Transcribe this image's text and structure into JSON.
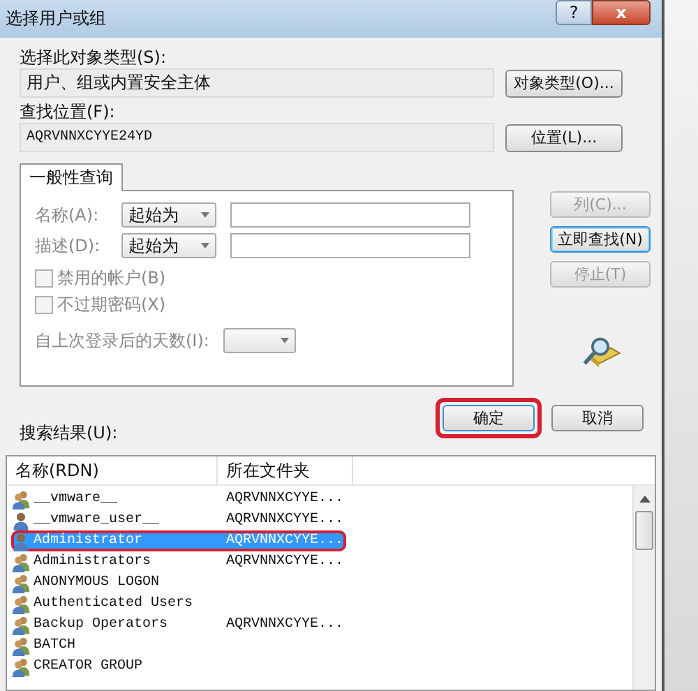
{
  "window": {
    "title": "选择用户或组",
    "help_button": "?",
    "close_button": "x"
  },
  "object_type": {
    "label": "选择此对象类型(S):",
    "value": "用户、组或内置安全主体",
    "button": "对象类型(O)..."
  },
  "location": {
    "label": "查找位置(F):",
    "value": "AQRVNNXCYYE24YD",
    "button": "位置(L)..."
  },
  "tabs": [
    {
      "label": "一般性查询",
      "selected": true
    }
  ],
  "query": {
    "rows": [
      {
        "label": "名称(A):",
        "mode": "起始为"
      },
      {
        "label": "描述(D):",
        "mode": "起始为"
      }
    ],
    "checkboxes": [
      {
        "label": "禁用的帐户(B)",
        "checked": false,
        "disabled": true
      },
      {
        "label": "不过期密码(X)",
        "checked": false,
        "disabled": true
      }
    ],
    "days_label": "自上次登录后的天数(I):"
  },
  "side_buttons": [
    {
      "label": "列(C)...",
      "disabled": true
    },
    {
      "label": "立即查找(N)",
      "disabled": false
    },
    {
      "label": "停止(T)",
      "disabled": true
    }
  ],
  "dialog_buttons": [
    {
      "label": "确定",
      "highlighted": true
    },
    {
      "label": "取消",
      "highlighted": false
    }
  ],
  "results": {
    "label": "搜索结果(U):",
    "columns": [
      "名称(RDN)",
      "所在文件夹"
    ],
    "rows": [
      {
        "kind": "group",
        "name": "__vmware__",
        "folder": "AQRVNNXCYYE...",
        "selected": false,
        "highlighted": false
      },
      {
        "kind": "user",
        "name": "__vmware_user__",
        "folder": "AQRVNNXCYYE...",
        "selected": false,
        "highlighted": false
      },
      {
        "kind": "user",
        "name": "Administrator",
        "folder": "AQRVNNXCYYE...",
        "selected": true,
        "highlighted": true
      },
      {
        "kind": "group",
        "name": "Administrators",
        "folder": "AQRVNNXCYYE...",
        "selected": false,
        "highlighted": false
      },
      {
        "kind": "group",
        "name": "ANONYMOUS LOGON",
        "folder": "",
        "selected": false,
        "highlighted": false
      },
      {
        "kind": "group",
        "name": "Authenticated Users",
        "folder": "",
        "selected": false,
        "highlighted": false
      },
      {
        "kind": "group",
        "name": "Backup Operators",
        "folder": "AQRVNNXCYYE...",
        "selected": false,
        "highlighted": false
      },
      {
        "kind": "group",
        "name": "BATCH",
        "folder": "",
        "selected": false,
        "highlighted": false
      },
      {
        "kind": "group",
        "name": "CREATOR GROUP",
        "folder": "",
        "selected": false,
        "highlighted": false
      }
    ]
  }
}
